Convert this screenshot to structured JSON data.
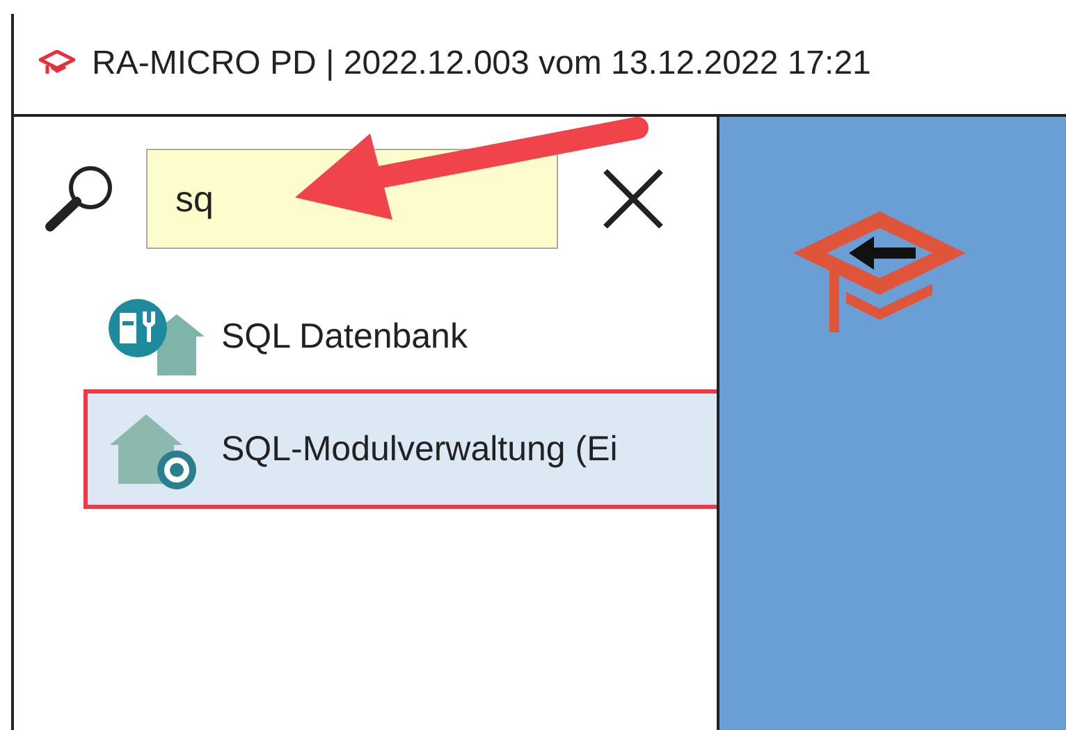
{
  "window": {
    "title": "RA-MICRO PD | 2022.12.003 vom 13.12.2022 17:21"
  },
  "search": {
    "value": "sq"
  },
  "results": [
    {
      "label": "SQL Datenbank",
      "kind": "database",
      "selected": false
    },
    {
      "label": "SQL-Modulverwaltung (Ei",
      "kind": "module",
      "selected": true
    }
  ]
}
